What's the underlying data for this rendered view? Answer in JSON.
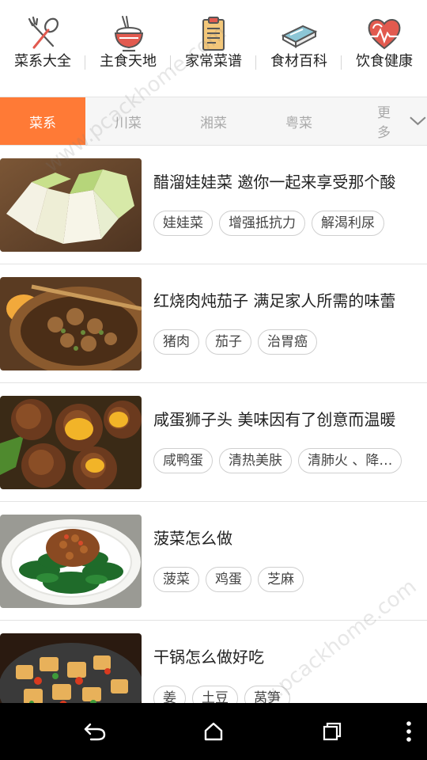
{
  "categories": [
    {
      "label": "菜系大全",
      "icon": "fork-spoon-icon"
    },
    {
      "label": "主食天地",
      "icon": "rice-bowl-icon"
    },
    {
      "label": "家常菜谱",
      "icon": "recipe-clipboard-icon"
    },
    {
      "label": "食材百科",
      "icon": "book-icon"
    },
    {
      "label": "饮食健康",
      "icon": "heart-pulse-icon"
    }
  ],
  "tabs": [
    {
      "label": "菜系",
      "active": true
    },
    {
      "label": "川菜",
      "active": false
    },
    {
      "label": "湘菜",
      "active": false
    },
    {
      "label": "粤菜",
      "active": false
    },
    {
      "label": "更多",
      "active": false
    }
  ],
  "recipes": [
    {
      "title": "醋溜娃娃菜 邀你一起来享受那个酸",
      "tags": [
        "娃娃菜",
        "增强抵抗力",
        "解渴利尿"
      ]
    },
    {
      "title": "红烧肉炖茄子 满足家人所需的味蕾",
      "tags": [
        "猪肉",
        "茄子",
        "治胃癌"
      ]
    },
    {
      "title": "咸蛋狮子头 美味因有了创意而温暖",
      "tags": [
        "咸鸭蛋",
        "清热美肤",
        "清肺火 、降…"
      ]
    },
    {
      "title": "菠菜怎么做",
      "tags": [
        "菠菜",
        "鸡蛋",
        "芝麻"
      ]
    },
    {
      "title": "干锅怎么做好吃",
      "tags": [
        "姜",
        "土豆",
        "莴笋"
      ]
    }
  ],
  "navbar": {
    "back": "back-icon",
    "home": "home-icon",
    "recents": "recents-icon",
    "menu": "overflow-menu-icon"
  },
  "watermark": "www.pcackhome.com",
  "colors": {
    "accent": "#ff7a36",
    "tab_bg": "#f6f6f6",
    "icon_red": "#e25a4f"
  }
}
